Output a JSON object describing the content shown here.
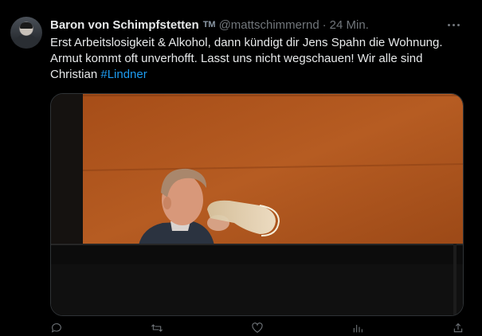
{
  "tweet": {
    "display_name": "Baron von Schimpfstetten",
    "name_suffix": "TM",
    "handle": "@mattschimmernd",
    "separator": "·",
    "time": "24 Min.",
    "text_main": "Erst Arbeitslosigkeit & Alkohol, dann kündigt dir Jens Spahn die Wohnung. Armut kommt oft unverhofft. Lasst uns nicht wegschauen! Wir alle sind Christian ",
    "hashtag": "#Lindner"
  },
  "actions": {
    "reply_icon": "reply-icon",
    "retweet_icon": "retweet-icon",
    "like_icon": "heart-icon",
    "views_icon": "views-icon",
    "share_icon": "share-icon"
  },
  "colors": {
    "background": "#000000",
    "text": "#e7e9ea",
    "muted": "#71767b",
    "link": "#1d9bf0",
    "wall": "#b0581f"
  }
}
